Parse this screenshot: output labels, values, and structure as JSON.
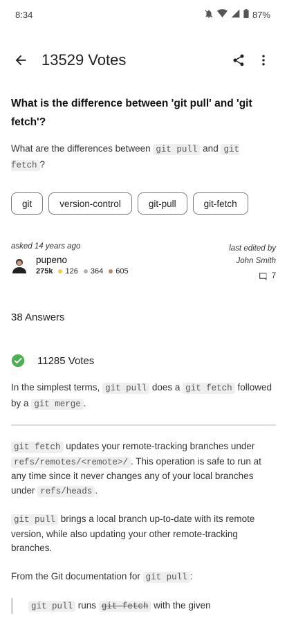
{
  "status_bar": {
    "time": "8:34",
    "battery": "87%"
  },
  "app_bar": {
    "title": "13529 Votes"
  },
  "question": {
    "title": "What is the difference between 'git pull' and 'git fetch'?",
    "body_text_1": "What are the differences between",
    "code_1": "git pull",
    "body_text_2": "and",
    "code_2": "git fetch",
    "body_text_3": "?",
    "tags": [
      "git",
      "version-control",
      "git-pull",
      "git-fetch"
    ]
  },
  "meta": {
    "asked": "asked 14 years ago",
    "user_name": "pupeno",
    "reputation": "275k",
    "gold": "126",
    "silver": "364",
    "bronze": "605",
    "edited_label": "last edited by",
    "editor": "John Smith",
    "comment_count": "7"
  },
  "answers_count": "38 Answers",
  "answer": {
    "votes": "11285 Votes",
    "intro_1": "In the simplest terms,",
    "intro_code_1": "git pull",
    "intro_2": "does a",
    "intro_code_2": "git fetch",
    "intro_3": "followed by a",
    "intro_code_3": "git merge",
    "intro_4": ".",
    "p1_code_1": "git fetch",
    "p1_text_1": "updates your remote-tracking branches under",
    "p1_code_2": "refs/remotes/<remote>/",
    "p1_text_2": ". This operation is safe to run at any time since it never changes any of your local branches under",
    "p1_code_3": "refs/heads",
    "p1_text_3": ".",
    "p2_code_1": "git pull",
    "p2_text_1": "brings a local branch up-to-date with its remote version, while also updating your other remote-tracking branches.",
    "p3_text_1": "From the Git documentation for",
    "p3_code_1": "git pull",
    "p3_text_2": ":",
    "quote_code_1": "git pull",
    "quote_text_1": "runs",
    "quote_code_2": "git fetch",
    "quote_text_2": "with the given"
  },
  "colors": {
    "accent_green": "#4caf50",
    "gold": "#f2c94c",
    "silver": "#b0b0b0",
    "bronze": "#b58b6a"
  }
}
